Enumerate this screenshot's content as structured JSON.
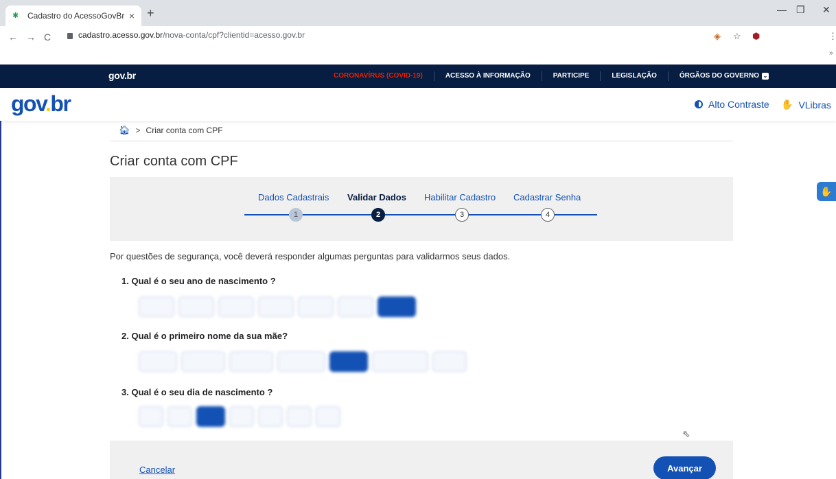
{
  "browser": {
    "tab_title": "Cadastro do AcessoGovBr",
    "tab_close": "×",
    "new_tab": "+",
    "url_host": "cadastro.acesso.gov.br",
    "url_path": "/nova-conta/cpf?clientid=acesso.gov.br",
    "controls": {
      "minimize": "—",
      "maximize": "❐",
      "close": "✕"
    },
    "nav": {
      "back": "←",
      "forward": "→",
      "reload": "C"
    },
    "overflow_menu": "⋮",
    "bookmarks_more": "»"
  },
  "govbar": {
    "logo": "gov.br",
    "links": [
      "CORONAVÍRUS (COVID-19)",
      "ACESSO À INFORMAÇÃO",
      "PARTICIPE",
      "LEGISLAÇÃO",
      "ÓRGÃOS DO GOVERNO"
    ]
  },
  "header": {
    "brand": {
      "g": "gov",
      "d": ".",
      "b": "br"
    },
    "high_contrast": "Alto Contraste",
    "vlibras": "VLibras"
  },
  "breadcrumb": {
    "current": "Criar conta com CPF",
    "separator": ">"
  },
  "page_title": "Criar conta com CPF",
  "steps": [
    {
      "label": "Dados Cadastrais",
      "number": "1",
      "state": "done"
    },
    {
      "label": "Validar Dados",
      "number": "2",
      "state": "active"
    },
    {
      "label": "Habilitar Cadastro",
      "number": "3",
      "state": "next"
    },
    {
      "label": "Cadastrar Senha",
      "number": "4",
      "state": "next"
    }
  ],
  "intro": "Por questões de segurança, você deverá responder algumas perguntas para validarmos seus dados.",
  "questions": [
    {
      "text": "1. Qual é o seu ano de nascimento ?"
    },
    {
      "text": "2. Qual é o primeiro nome da sua mãe?"
    },
    {
      "text": "3. Qual é o seu dia de nascimento ?"
    }
  ],
  "footer": {
    "cancel": "Cancelar",
    "next": "Avançar"
  },
  "colors": {
    "gov_blue": "#1351b4",
    "gov_dark": "#071d41",
    "covid_red": "#e52207",
    "brand_yellow": "#ffcd07"
  }
}
